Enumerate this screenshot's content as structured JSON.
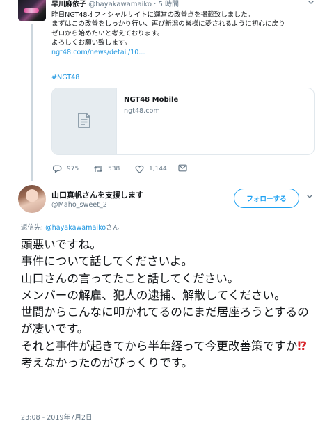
{
  "parent_tweet": {
    "name": "早川麻依子",
    "handle": "@hayakawamaiko",
    "separator": "·",
    "time": "5 時間",
    "lines": [
      "昨日NGT48オフィシャルサイトに運営の改善点を掲載致しました。",
      "まずはこの改善をしっかり行い、再び新潟の皆様に愛されるように初心に戻り",
      "ゼロから始めたいと考えております。",
      "よろしくお願い致します。"
    ],
    "link": "ngt48.com/news/detail/10...",
    "hashtag": "#NGT48",
    "card": {
      "title": "NGT48 Mobile",
      "domain": "ngt48.com",
      "icon": "document-icon"
    },
    "actions": {
      "reply_count": "975",
      "retweet_count": "538",
      "like_count": "1,144"
    }
  },
  "main_tweet": {
    "name": "山口真帆さんを支援します",
    "handle": "@Maho_sweet_2",
    "follow_label": "フォローする",
    "reply_prefix": "返信先: ",
    "reply_handle": "@hayakawamaiko",
    "reply_suffix": "さん",
    "lines": [
      "頭悪いですね。",
      "事件について話してくださいよ。",
      "山口さんの言ってたこと話してください。",
      "メンバーの解雇、犯人の逮捕、解散してください。",
      "世間からこんなに叩かれてるのにまだ居座ろうとするのが凄いです。",
      "それと事件が起きてから半年経って今更改善策ですか",
      "考えなかったのがびっくりです。"
    ],
    "emphasis": "⁉",
    "timestamp": "23:08 - 2019年7月2日"
  },
  "colors": {
    "accent": "#1da1f2",
    "link": "#1b95e0",
    "muted": "#657786",
    "border": "#e1e8ed",
    "emphasis_red": "#d8262c"
  }
}
